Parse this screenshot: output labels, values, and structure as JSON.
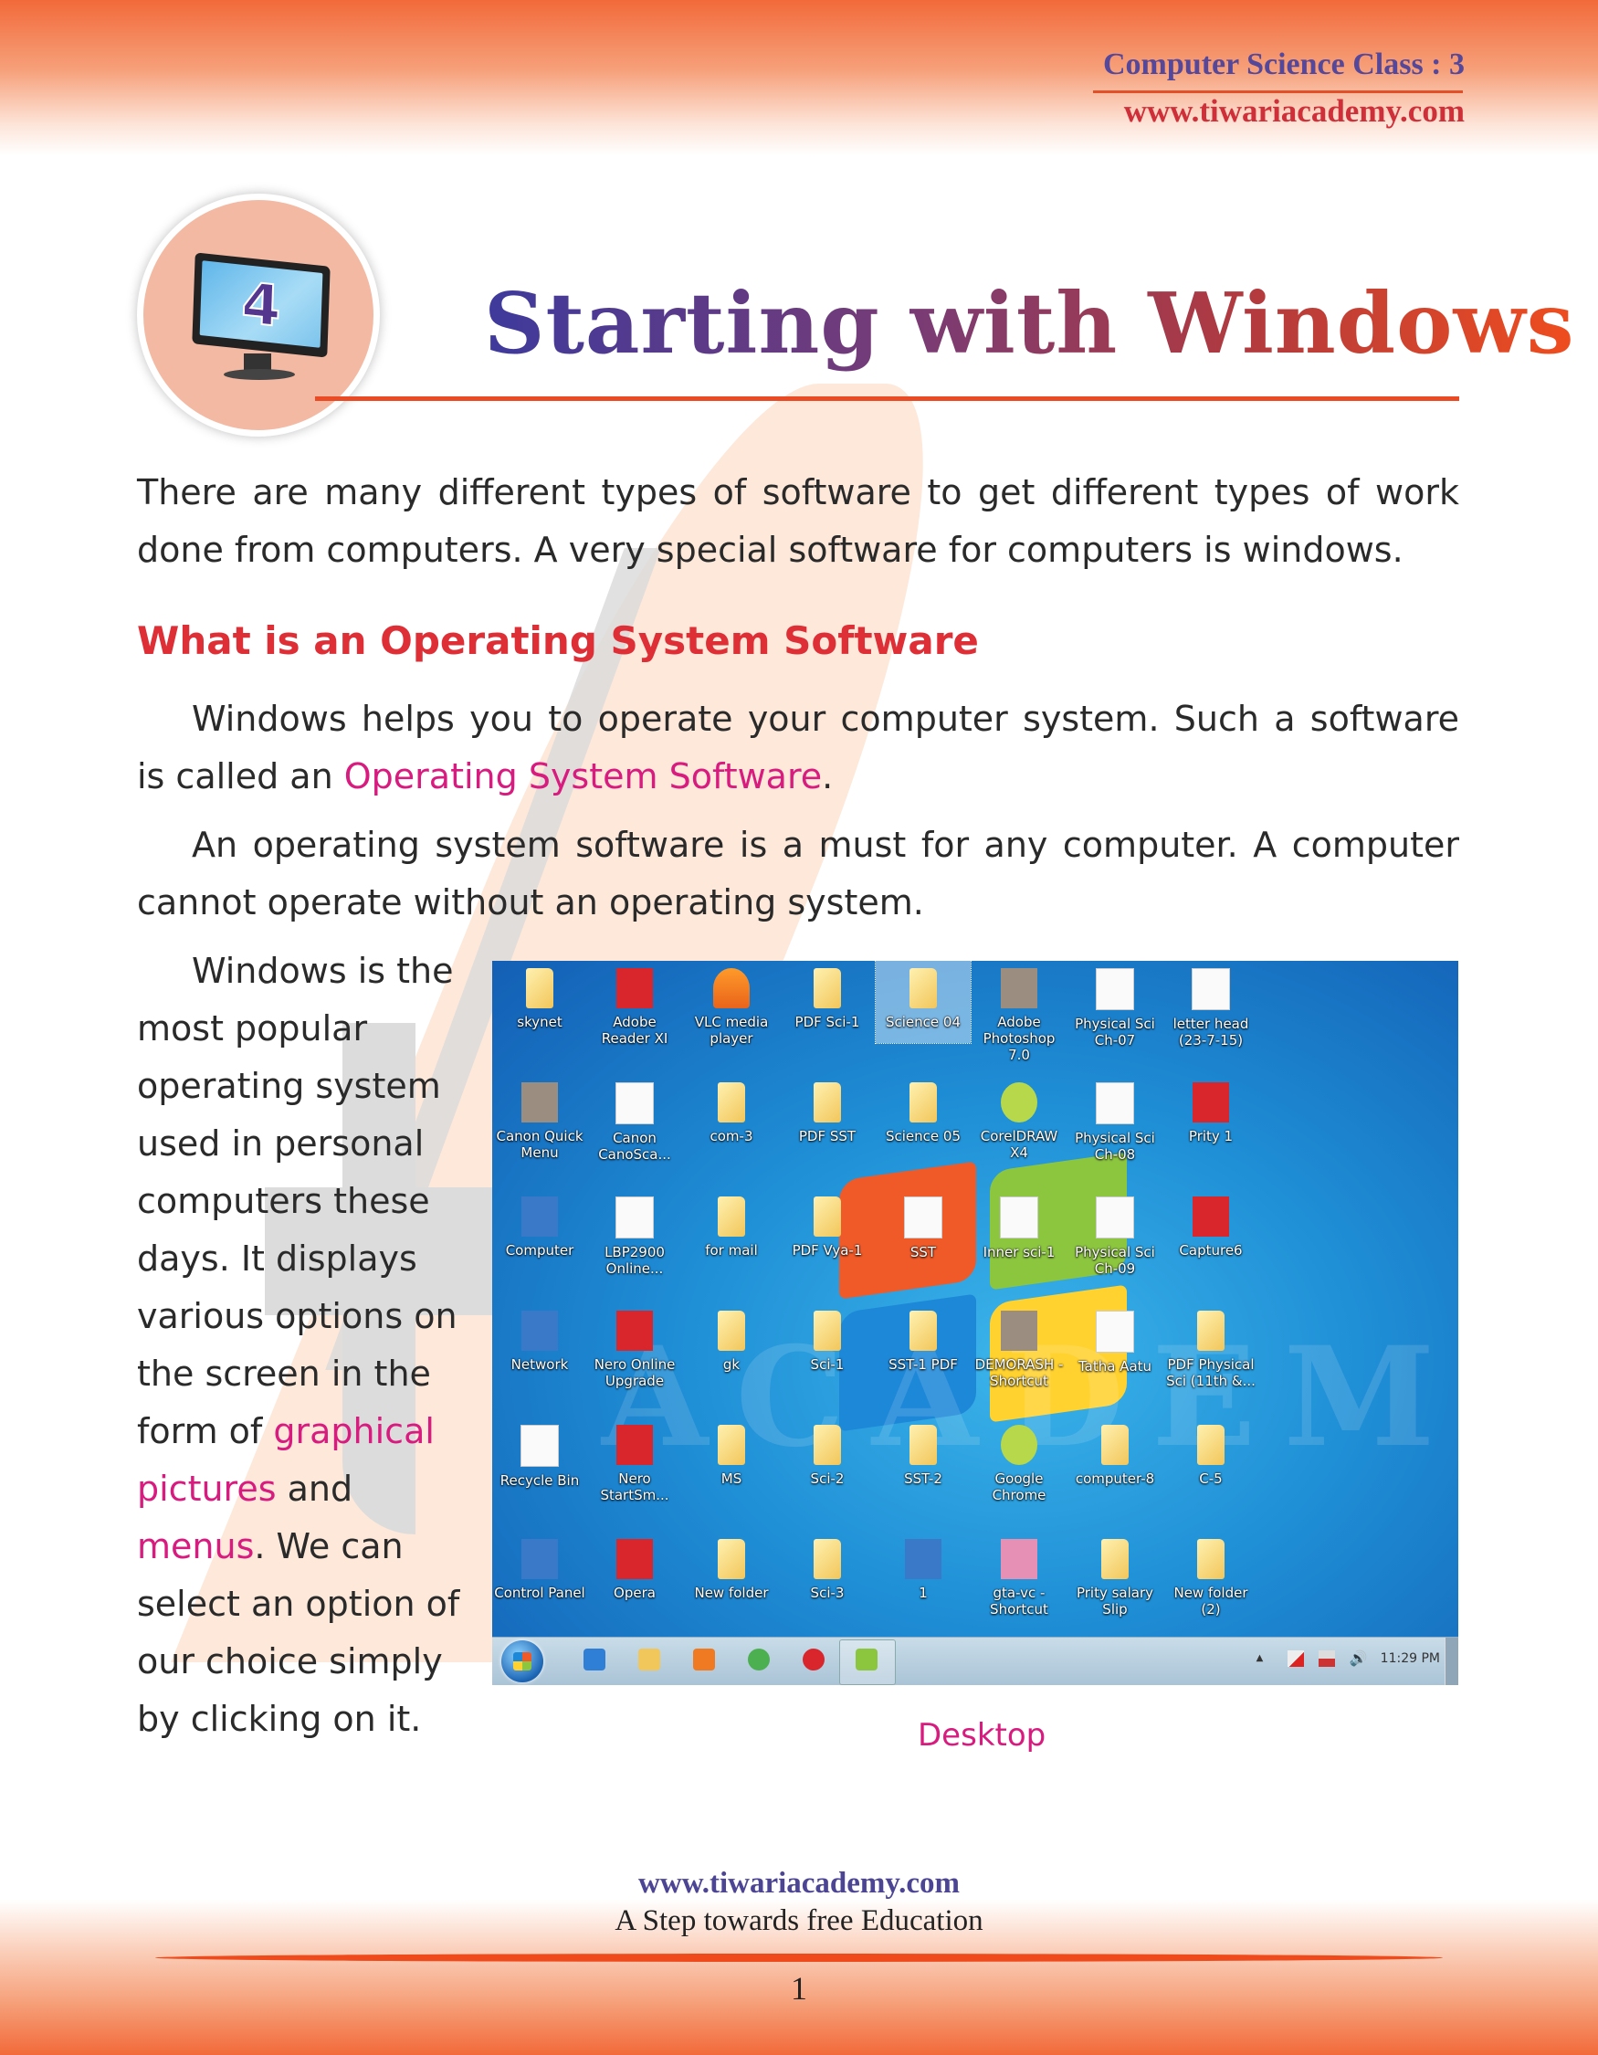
{
  "header": {
    "class_label": "Computer Science Class : 3",
    "website": "www.tiwariacademy.com"
  },
  "chapter": {
    "number": "4",
    "title": "Starting with Windows"
  },
  "intro": "There are many different types of software to get different types of work done from computers. A very special software for computers is windows.",
  "section": {
    "heading": "What is an Operating System Software",
    "p1_before": "Windows helps you to operate your computer system. Such a software is called an ",
    "p1_highlight": "Operating System Software",
    "p1_after": ".",
    "p2": "An operating system software is a must for any computer. A computer cannot operate without an operating system."
  },
  "side_text": {
    "lines": [
      "Windows is the",
      "most popular",
      "operating system",
      "used in personal",
      "computers these",
      "days. It displays",
      "various options on",
      "the screen in the"
    ],
    "line9_before": "form of ",
    "line9_pink": "graphical",
    "line10_pink": "pictures",
    "line10_after": " and",
    "line11_pink": "menus",
    "line11_after": ". We can",
    "tail_lines": [
      "select an option of",
      "our choice simply",
      "by clicking on it."
    ]
  },
  "desktop": {
    "watermark": "ACADEMY",
    "icons": [
      {
        "label": "skynet",
        "type": "folder-user"
      },
      {
        "label": "Adobe Reader XI",
        "type": "app-red"
      },
      {
        "label": "VLC media player",
        "type": "app-orange"
      },
      {
        "label": "PDF Sci-1",
        "type": "folder"
      },
      {
        "label": "Science 04",
        "type": "folder",
        "selected": true
      },
      {
        "label": "Adobe Photoshop 7.0",
        "type": "app-grey"
      },
      {
        "label": "Physical Sci Ch-07",
        "type": "doc"
      },
      {
        "label": "letter head (23-7-15)",
        "type": "doc"
      },
      {
        "label": "Canon Quick Menu",
        "type": "app-grey"
      },
      {
        "label": "Canon CanoSca...",
        "type": "doc"
      },
      {
        "label": "com-3",
        "type": "folder"
      },
      {
        "label": "PDF SST",
        "type": "folder"
      },
      {
        "label": "Science 05",
        "type": "folder"
      },
      {
        "label": "CorelDRAW X4",
        "type": "app-green"
      },
      {
        "label": "Physical Sci Ch-08",
        "type": "doc"
      },
      {
        "label": "Prity 1",
        "type": "app-red"
      },
      {
        "label": "Computer",
        "type": "app-blue"
      },
      {
        "label": "LBP2900 Online...",
        "type": "doc"
      },
      {
        "label": "for mail",
        "type": "folder"
      },
      {
        "label": "PDF Vya-1",
        "type": "folder"
      },
      {
        "label": "SST",
        "type": "doc"
      },
      {
        "label": "Inner sci-1",
        "type": "doc"
      },
      {
        "label": "Physical Sci Ch-09",
        "type": "doc"
      },
      {
        "label": "Capture6",
        "type": "app-red"
      },
      {
        "label": "Network",
        "type": "app-blue"
      },
      {
        "label": "Nero Online Upgrade",
        "type": "app-red"
      },
      {
        "label": "gk",
        "type": "folder"
      },
      {
        "label": "Sci-1",
        "type": "folder"
      },
      {
        "label": "SST-1 PDF",
        "type": "folder"
      },
      {
        "label": "DEMORASH - Shortcut",
        "type": "app-grey"
      },
      {
        "label": "Tatha Aatu",
        "type": "doc"
      },
      {
        "label": "PDF Physical Sci (11th &...",
        "type": "folder"
      },
      {
        "label": "Recycle Bin",
        "type": "doc"
      },
      {
        "label": "Nero StartSm...",
        "type": "app-red"
      },
      {
        "label": "MS",
        "type": "folder"
      },
      {
        "label": "Sci-2",
        "type": "folder"
      },
      {
        "label": "SST-2",
        "type": "folder"
      },
      {
        "label": "Google Chrome",
        "type": "app-green"
      },
      {
        "label": "computer-8",
        "type": "folder"
      },
      {
        "label": "C-5",
        "type": "folder"
      },
      {
        "label": "Control Panel",
        "type": "app-blue"
      },
      {
        "label": "Opera",
        "type": "app-red"
      },
      {
        "label": "New folder",
        "type": "folder"
      },
      {
        "label": "Sci-3",
        "type": "folder"
      },
      {
        "label": "1",
        "type": "app-blue"
      },
      {
        "label": "gta-vc - Shortcut",
        "type": "app-pink"
      },
      {
        "label": "Prity salary Slip",
        "type": "folder"
      },
      {
        "label": "New folder (2)",
        "type": "folder"
      }
    ],
    "taskbar": {
      "pinned": [
        {
          "name": "internet-explorer",
          "color": "#2f7fd6"
        },
        {
          "name": "windows-explorer",
          "color": "#f1c65a"
        },
        {
          "name": "media-player",
          "color": "#ef7a21"
        },
        {
          "name": "chrome",
          "color": "#4caf50"
        },
        {
          "name": "opera",
          "color": "#d8262c"
        },
        {
          "name": "active-app",
          "color": "#8cc63f"
        }
      ],
      "clock": "11:29 PM"
    }
  },
  "caption": "Desktop",
  "footer": {
    "website": "www.tiwariacademy.com",
    "tagline": "A Step towards free Education",
    "page_number": "1"
  }
}
